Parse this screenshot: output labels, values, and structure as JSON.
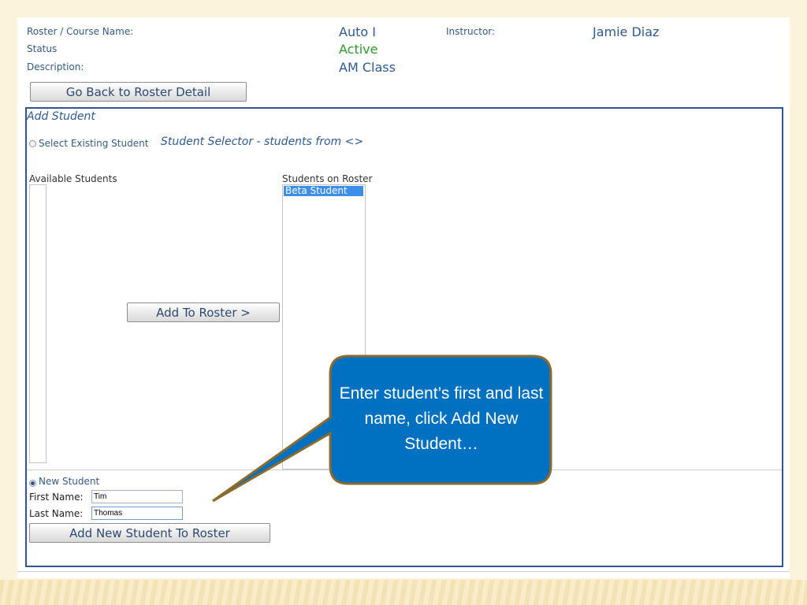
{
  "header": {
    "course_label": "Roster / Course Name:",
    "course_value": "Auto I",
    "instructor_label": "Instructor:",
    "instructor_value": "Jamie Diaz",
    "status_label": "Status",
    "status_value": "Active",
    "description_label": "Description:",
    "description_value": "AM Class"
  },
  "back_button_label": "Go Back to Roster Detail",
  "add_student": {
    "title": "Add Student",
    "existing_radio_label": "Select Existing Student",
    "selector_title": "Student Selector - students from <>",
    "available_label": "Available Students",
    "roster_label": "Students on Roster",
    "available_items": [],
    "roster_items": [
      "Beta Student"
    ],
    "add_to_roster_label": "Add To Roster >",
    "new_radio_label": "New Student",
    "selected_option": "New Student",
    "first_name_label": "First Name:",
    "first_name_value": "Tim",
    "last_name_label": "Last Name:",
    "last_name_value": "Thomas",
    "add_new_button_label": "Add New Student To Roster"
  },
  "callout": {
    "text": "Enter student’s first and last name, click Add New Student…",
    "fill_color": "#0070c0",
    "border_color": "#8a6a2e"
  }
}
